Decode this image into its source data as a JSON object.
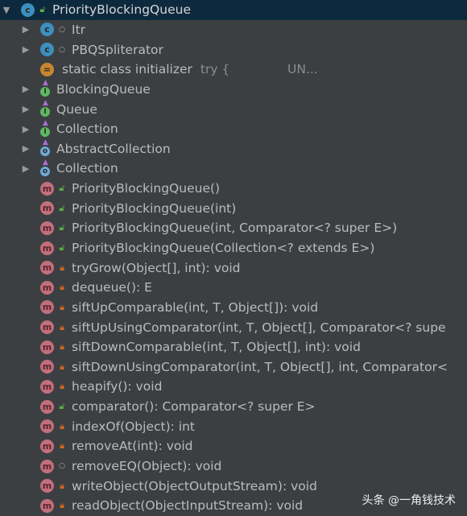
{
  "rows": [
    {
      "level": 0,
      "arrow": "down",
      "icon": "class",
      "access": "pub",
      "text": "PriorityBlockingQueue",
      "selected": true
    },
    {
      "level": 1,
      "arrow": "right",
      "icon": "class",
      "access": "pkg",
      "text": "Itr"
    },
    {
      "level": 1,
      "arrow": "right",
      "icon": "class",
      "access": "pkg",
      "text": "PBQSpliterator"
    },
    {
      "level": 1,
      "arrow": "",
      "icon": "init",
      "access": "",
      "text": "static class initializer",
      "extra": "try {",
      "extra2": "UN..."
    },
    {
      "level": 1,
      "arrow": "right",
      "icon": "iface",
      "access": "",
      "text": "BlockingQueue"
    },
    {
      "level": 1,
      "arrow": "right",
      "icon": "iface",
      "access": "",
      "text": "Queue"
    },
    {
      "level": 1,
      "arrow": "right",
      "icon": "iface",
      "access": "",
      "text": "Collection"
    },
    {
      "level": 1,
      "arrow": "right",
      "icon": "abs",
      "access": "",
      "text": "AbstractCollection"
    },
    {
      "level": 1,
      "arrow": "right",
      "icon": "abs",
      "access": "",
      "text": "Collection"
    },
    {
      "level": 1,
      "arrow": "",
      "icon": "method",
      "access": "pub",
      "text": "PriorityBlockingQueue()"
    },
    {
      "level": 1,
      "arrow": "",
      "icon": "method",
      "access": "pub",
      "text": "PriorityBlockingQueue(int)"
    },
    {
      "level": 1,
      "arrow": "",
      "icon": "method",
      "access": "pub",
      "text": "PriorityBlockingQueue(int, Comparator<? super E>)"
    },
    {
      "level": 1,
      "arrow": "",
      "icon": "method",
      "access": "pub",
      "text": "PriorityBlockingQueue(Collection<? extends E>)"
    },
    {
      "level": 1,
      "arrow": "",
      "icon": "method",
      "access": "priv",
      "text": "tryGrow(Object[], int): void"
    },
    {
      "level": 1,
      "arrow": "",
      "icon": "method",
      "access": "priv",
      "text": "dequeue(): E"
    },
    {
      "level": 1,
      "arrow": "",
      "icon": "method",
      "access": "priv",
      "text": "siftUpComparable(int, T, Object[]): void"
    },
    {
      "level": 1,
      "arrow": "",
      "icon": "method",
      "access": "priv",
      "text": "siftUpUsingComparator(int, T, Object[], Comparator<? supe"
    },
    {
      "level": 1,
      "arrow": "",
      "icon": "method",
      "access": "priv",
      "text": "siftDownComparable(int, T, Object[], int): void"
    },
    {
      "level": 1,
      "arrow": "",
      "icon": "method",
      "access": "priv",
      "text": "siftDownUsingComparator(int, T, Object[], int, Comparator<"
    },
    {
      "level": 1,
      "arrow": "",
      "icon": "method",
      "access": "priv",
      "text": "heapify(): void"
    },
    {
      "level": 1,
      "arrow": "",
      "icon": "method",
      "access": "pub",
      "text": "comparator(): Comparator<? super E>"
    },
    {
      "level": 1,
      "arrow": "",
      "icon": "method",
      "access": "priv",
      "text": "indexOf(Object): int"
    },
    {
      "level": 1,
      "arrow": "",
      "icon": "method",
      "access": "priv",
      "text": "removeAt(int): void"
    },
    {
      "level": 1,
      "arrow": "",
      "icon": "method",
      "access": "pkg",
      "text": "removeEQ(Object): void"
    },
    {
      "level": 1,
      "arrow": "",
      "icon": "method",
      "access": "priv",
      "text": "writeObject(ObjectOutputStream): void"
    },
    {
      "level": 1,
      "arrow": "",
      "icon": "method",
      "access": "priv",
      "text": "readObject(ObjectInputStream): void"
    }
  ],
  "watermark": "头条 @一角钱技术"
}
